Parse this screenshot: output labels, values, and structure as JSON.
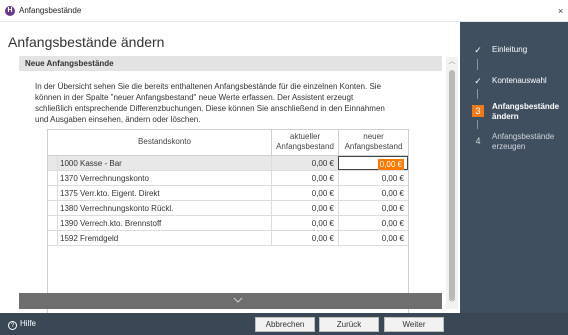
{
  "window": {
    "title": "Anfangsbestände",
    "app_icon_letter": "H",
    "close_glyph": "×"
  },
  "page": {
    "title": "Anfangsbestände ändern",
    "section_title": "Neue Anfangsbestände",
    "intro_lines": [
      "In der Übersicht sehen Sie die bereits enthaltenen Anfangsbestände für die einzelnen Konten. Sie",
      "können in der Spalte \"neuer Anfangsbestand\" neue Werte erfassen. Der Assistent erzeugt",
      "schließlich entsprechende Differenzbuchungen. Diese können Sie anschließend in den Einnahmen",
      "und Ausgaben einsehen, ändern oder löschen."
    ]
  },
  "table": {
    "headers": {
      "name": "Bestandskonto",
      "current_1": "aktueller",
      "current_2": "Anfangsbestand",
      "new_1": "neuer",
      "new_2": "Anfangsbestand"
    },
    "rows": [
      {
        "name": "1000 Kasse - Bar",
        "current": "0,00 €",
        "new": "0,00 €"
      },
      {
        "name": "1370 Verrechnungskonto",
        "current": "0,00 €",
        "new": "0,00 €"
      },
      {
        "name": "1375 Verr.kto. Eigent. Direkt",
        "current": "0,00 €",
        "new": "0,00 €"
      },
      {
        "name": "1380 Verrechnungskonto Rückl.",
        "current": "0,00 €",
        "new": "0,00 €"
      },
      {
        "name": "1390 Verrech.kto. Brennstoff",
        "current": "0,00 €",
        "new": "0,00 €"
      },
      {
        "name": "1592 Fremdgeld",
        "current": "0,00 €",
        "new": "0,00 €"
      }
    ]
  },
  "sidebar": {
    "steps": [
      {
        "mark": "✓",
        "label_1": "Einleitung",
        "label_2": "",
        "state": "done"
      },
      {
        "mark": "✓",
        "label_1": "Kontenauswahl",
        "label_2": "",
        "state": "done"
      },
      {
        "mark": "3",
        "label_1": "Anfangsbestände",
        "label_2": "ändern",
        "state": "active"
      },
      {
        "mark": "4",
        "label_1": "Anfangsbestände",
        "label_2": "erzeugen",
        "state": "pending"
      }
    ]
  },
  "footer": {
    "help_label": "Hilfe",
    "help_glyph": "?",
    "cancel_label": "Abbrechen",
    "back_label": "Zurück",
    "next_label": "Weiter"
  },
  "colors": {
    "sidebar_bg": "#3f4f60",
    "footer_bg": "#3a4856",
    "accent": "#f07a1a",
    "selection": "#ff7a00",
    "brand": "#6a3c86"
  }
}
